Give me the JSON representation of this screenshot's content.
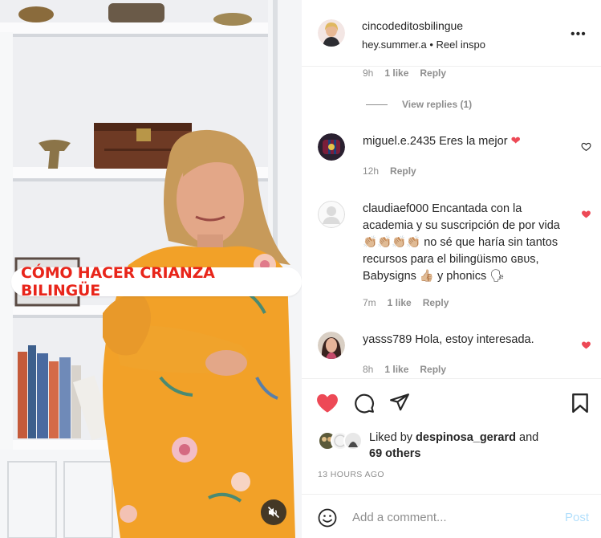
{
  "media": {
    "overlay_caption": "CÓMO HACER CRIANZA BILINGÜE",
    "mute_icon": "speaker-muted-icon"
  },
  "header": {
    "username": "cincodeditosbilingue",
    "audio_source": "hey.summer.a",
    "separator": "•",
    "audio_title": "Reel inspo",
    "more_icon": "more-horizontal-icon",
    "more_label": "•••"
  },
  "prev_comment_meta": {
    "time": "9h",
    "likes": "1 like",
    "reply": "Reply"
  },
  "view_replies": "View replies (1)",
  "comments": [
    {
      "username": "miguel.e.2435",
      "text": "Eres la mejor",
      "emoji": "❤",
      "time": "12h",
      "likes": "",
      "reply": "Reply",
      "liked": false
    },
    {
      "username": "claudiaef000",
      "text": "Encantada con la academia y su suscripción de por vida 👏🏼👏🏼👏🏼👏🏼 no sé que haría sin tantos recursos para el bilingüismo ɢʙᴜs, Babysigns 👍🏼 y phonics 🗣",
      "time": "7m",
      "likes": "1 like",
      "reply": "Reply",
      "liked": true
    },
    {
      "username": "yasss789",
      "text": "Hola, estoy interesada.",
      "time": "8h",
      "likes": "1 like",
      "reply": "Reply",
      "liked": true
    }
  ],
  "likes": {
    "prefix": "Liked by",
    "user": "despinosa_gerard",
    "connector": "and",
    "others": "69 others"
  },
  "timestamp": "13 HOURS AGO",
  "add_comment": {
    "placeholder": "Add a comment...",
    "post_label": "Post"
  },
  "colors": {
    "heart_red": "#ed4956",
    "caption_red": "#e8251a",
    "post_blue": "#b2dffc",
    "meta_gray": "#8e8e8e"
  }
}
